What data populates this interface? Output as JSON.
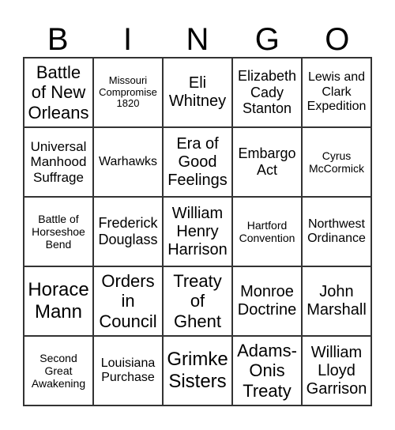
{
  "header": {
    "letters": [
      "B",
      "I",
      "N",
      "G",
      "O"
    ]
  },
  "cells": [
    "Battle\nof New\nOrleans",
    "Missouri\nCompromise\n1820",
    "Eli\nWhitney",
    "Elizabeth\nCady\nStanton",
    "Lewis and\nClark\nExpedition",
    "Universal\nManhood\nSuffrage",
    "Warhawks",
    "Era of\nGood\nFeelings",
    "Embargo\nAct",
    "Cyrus\nMcCormick",
    "Battle of\nHorseshoe\nBend",
    "Frederick\nDouglass",
    "William\nHenry\nHarrison",
    "Hartford\nConvention",
    "Northwest\nOrdinance",
    "Horace\nMann",
    "Orders\nin\nCouncil",
    "Treaty\nof\nGhent",
    "Monroe\nDoctrine",
    "John\nMarshall",
    "Second\nGreat\nAwakening",
    "Louisiana\nPurchase",
    "Grimke\nSisters",
    "Adams-\nOnis\nTreaty",
    "William\nLloyd\nGarrison"
  ]
}
